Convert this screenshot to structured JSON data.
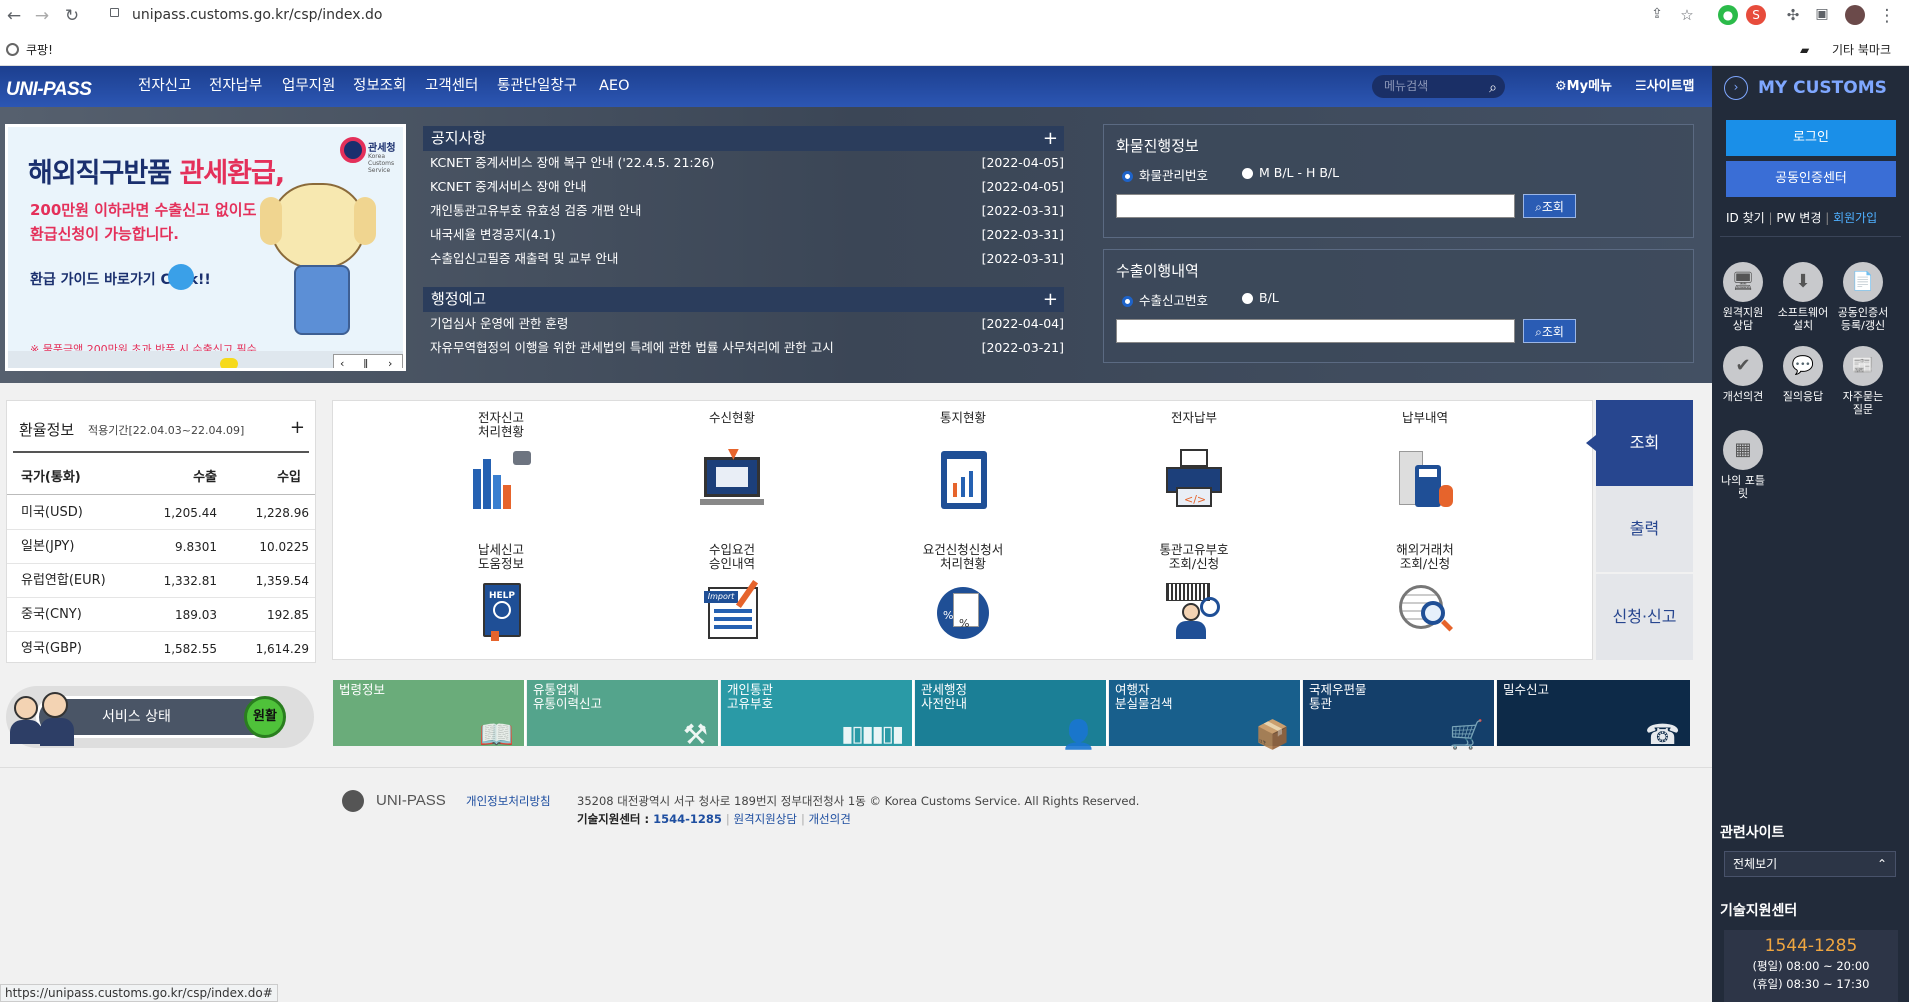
{
  "browser": {
    "url": "unipass.customs.go.kr/csp/index.do",
    "bookmark_left": "쿠팡!",
    "bookmark_right": "기타 북마크"
  },
  "topnav": {
    "logo": "UNI-PASS",
    "menu": [
      "전자신고",
      "전자납부",
      "업무지원",
      "정보조회",
      "고객센터",
      "통관단일창구",
      "AEO"
    ],
    "search_placeholder": "메뉴검색",
    "mymenu": "My메뉴",
    "sitemap": "사이트맵"
  },
  "ad": {
    "headline_a": "해외직구반품 ",
    "headline_b": "관세환급,",
    "line2": "200만원 이하라면 수출신고 없이도",
    "line3": "환급신청이 가능합니다.",
    "guide": "환급 가이드 바로가기 Click!!",
    "footnote": "※ 물품금액 200만원 초과 반품 시 수출신고 필수",
    "agency": "관세청",
    "agency_en": "Korea Customs Service"
  },
  "notice": {
    "title": "공지사항",
    "items": [
      {
        "text": "KCNET 중계서비스 장애 복구 안내 ('22.4.5. 21:26)",
        "date": "[2022-04-05]"
      },
      {
        "text": "KCNET 중계서비스 장애 안내",
        "date": "[2022-04-05]"
      },
      {
        "text": "개인통관고유부호 유효성 검증 개편 안내",
        "date": "[2022-03-31]"
      },
      {
        "text": "내국세율 변경공지(4.1)",
        "date": "[2022-03-31]"
      },
      {
        "text": "수출입신고필증 재출력 및 교부 안내",
        "date": "[2022-03-31]"
      }
    ]
  },
  "admin_notice": {
    "title": "행정예고",
    "items": [
      {
        "text": "기업심사 운영에 관한 훈령",
        "date": "[2022-04-04]"
      },
      {
        "text": "자유무역협정의 이행을 위한 관세법의 특례에 관한 법률 사무처리에 관한 고시",
        "date": "[2022-03-21]"
      }
    ]
  },
  "cargo": {
    "title": "화물진행정보",
    "opt1": "화물관리번호",
    "opt2": "M B/L - H B/L",
    "btn": "조회"
  },
  "export": {
    "title": "수출이행내역",
    "opt1": "수출신고번호",
    "opt2": "B/L",
    "btn": "조회"
  },
  "fx": {
    "title": "환율정보",
    "period": "적용기간[22.04.03~22.04.09]",
    "headers": [
      "국가(통화)",
      "수출",
      "수입"
    ],
    "rows": [
      [
        "미국(USD)",
        "1,205.44",
        "1,228.96"
      ],
      [
        "일본(JPY)",
        "9.8301",
        "10.0225"
      ],
      [
        "유럽연합(EUR)",
        "1,332.81",
        "1,359.54"
      ],
      [
        "중국(CNY)",
        "189.03",
        "192.85"
      ],
      [
        "영국(GBP)",
        "1,582.55",
        "1,614.29"
      ]
    ]
  },
  "service": {
    "label": "서비스 상태",
    "status": "원활"
  },
  "grid": [
    {
      "l1": "전자신고",
      "l2": "처리현황",
      "icon": "bar-chart-icon"
    },
    {
      "l1": "수신현황",
      "l2": "",
      "icon": "monitor-mail-icon"
    },
    {
      "l1": "통지현황",
      "l2": "",
      "icon": "report-icon"
    },
    {
      "l1": "전자납부",
      "l2": "",
      "icon": "printer-icon"
    },
    {
      "l1": "납부내역",
      "l2": "",
      "icon": "calculator-icon"
    },
    {
      "l1": "납세신고",
      "l2": "도움정보",
      "icon": "help-book-icon"
    },
    {
      "l1": "수입요건",
      "l2": "승인내역",
      "icon": "import-doc-icon"
    },
    {
      "l1": "요건신청신청서",
      "l2": "처리현황",
      "icon": "percent-doc-icon"
    },
    {
      "l1": "통관고유부호",
      "l2": "조회/신청",
      "icon": "barcode-person-icon"
    },
    {
      "l1": "해외거래처",
      "l2": "조회/신청",
      "icon": "globe-search-icon"
    }
  ],
  "side_tabs": [
    "조회",
    "출력",
    "신청·신고"
  ],
  "tiles": [
    {
      "l1": "법령정보",
      "l2": "",
      "color": "#6aac7a",
      "icon": "book-icon"
    },
    {
      "l1": "유통업체",
      "l2": "유통이력신고",
      "color": "#54a48c",
      "icon": "hammer-icon"
    },
    {
      "l1": "개인통관",
      "l2": "고유부호",
      "color": "#2a9aa6",
      "icon": "barcode-icon"
    },
    {
      "l1": "관세행정",
      "l2": "사전안내",
      "color": "#1b7f96",
      "icon": "person-icon"
    },
    {
      "l1": "여행자",
      "l2": "분실물검색",
      "color": "#185f8c",
      "icon": "box-icon"
    },
    {
      "l1": "국제우편물",
      "l2": "통관",
      "color": "#143f6a",
      "icon": "cart-icon"
    },
    {
      "l1": "밀수신고",
      "l2": "",
      "color": "#0d2a48",
      "icon": "phone-24h-icon"
    }
  ],
  "footer": {
    "brand": "UNI-PASS",
    "privacy": "개인정보처리방침",
    "address": "35208 대전광역시 서구 청사로 189번지 정부대전청사 1동 © Korea Customs Service. All Rights Reserved.",
    "tech_label": "기술지원센터 : ",
    "tech_phone": "1544-1285",
    "remote": "원격지원상담",
    "improve": "개선의견"
  },
  "right_panel": {
    "title": "MY CUSTOMS",
    "login": "로그인",
    "cert": "공동인증센터",
    "id_find": "ID 찾기",
    "pw_change": "PW 변경",
    "join": "회원가입",
    "tools": [
      {
        "l1": "원격지원",
        "l2": "상담",
        "icon": "remote-icon"
      },
      {
        "l1": "소프트웨어",
        "l2": "설치",
        "icon": "download-icon"
      },
      {
        "l1": "공동인증서",
        "l2": "등록/갱신",
        "icon": "certificate-icon"
      },
      {
        "l1": "개선의견",
        "l2": "",
        "icon": "check-icon"
      },
      {
        "l1": "질의응답",
        "l2": "",
        "icon": "qna-icon"
      },
      {
        "l1": "자주묻는",
        "l2": "질문",
        "icon": "faq-icon"
      },
      {
        "l1": "나의 포틀",
        "l2": "릿",
        "icon": "portlet-icon"
      }
    ],
    "related_title": "관련사이트",
    "related_select": "전체보기",
    "tech_title": "기술지원센터",
    "tech_phone": "1544-1285",
    "weekday": "(평일) 08:00 ~ 20:00",
    "holiday": "(휴일) 08:30 ~ 17:30"
  },
  "status_bar": "https://unipass.customs.go.kr/csp/index.do#"
}
